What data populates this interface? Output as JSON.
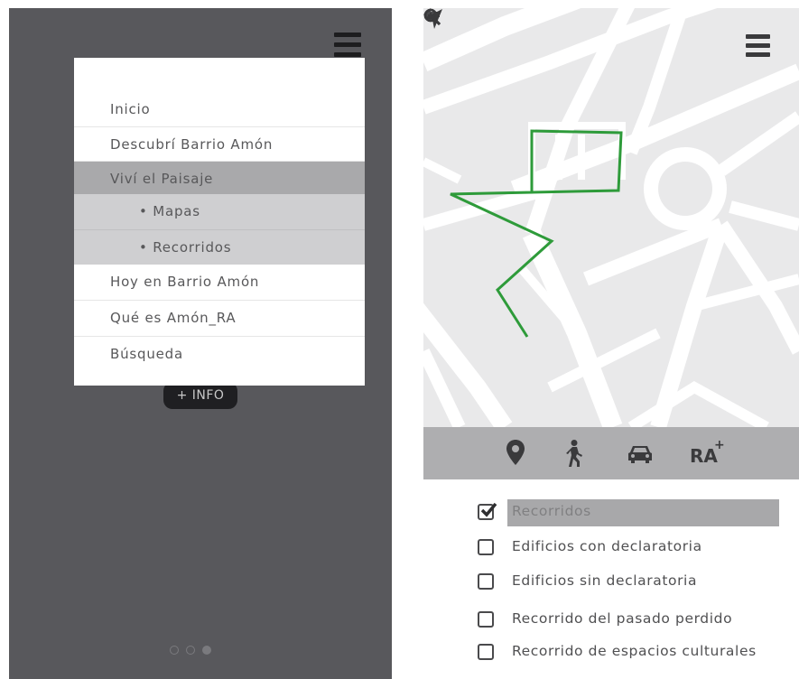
{
  "left_screen": {
    "menu": [
      {
        "label": "Inicio",
        "style": "normal"
      },
      {
        "label": "Descubrí Barrio Amón",
        "style": "normal"
      },
      {
        "label": "Viví el Paisaje",
        "style": "active"
      },
      {
        "label": "• Mapas",
        "style": "sub"
      },
      {
        "label": "• Recorridos",
        "style": "sub"
      },
      {
        "label": "Hoy en Barrio Amón",
        "style": "normal"
      },
      {
        "label": "Qué es Amón_RA",
        "style": "normal"
      },
      {
        "label": "Búsqueda",
        "style": "normal"
      }
    ],
    "info_button_label": "+ INFO",
    "pagination": {
      "count": 3,
      "active": 3
    }
  },
  "right_screen": {
    "icons": {
      "back": "back-arrow-icon",
      "navigate": "navigation-arrow-icon",
      "menu": "hamburger-menu-icon",
      "zoom_out": "zoom-out-icon",
      "zoom_in": "zoom-in-icon"
    },
    "toolbar": {
      "tools": [
        "location-pin-icon",
        "walking-person-icon",
        "car-icon"
      ],
      "ra_label": "RA",
      "ra_superscript": "+"
    },
    "options": [
      {
        "label": "Recorridos",
        "checked": true
      },
      {
        "label": "Edificios con declaratoria",
        "checked": false
      },
      {
        "label": "Edificios sin declaratoria",
        "checked": false
      },
      {
        "label": "Recorrido del pasado perdido",
        "checked": false
      },
      {
        "label": "Recorrido de espacios culturales",
        "checked": false
      }
    ]
  },
  "colors": {
    "dark_bg": "#58585c",
    "route_green": "#2e9b3a",
    "menu_active": "#a9a9ab",
    "menu_sub": "#cfcfd1",
    "toolbar": "#aeaeb0"
  }
}
